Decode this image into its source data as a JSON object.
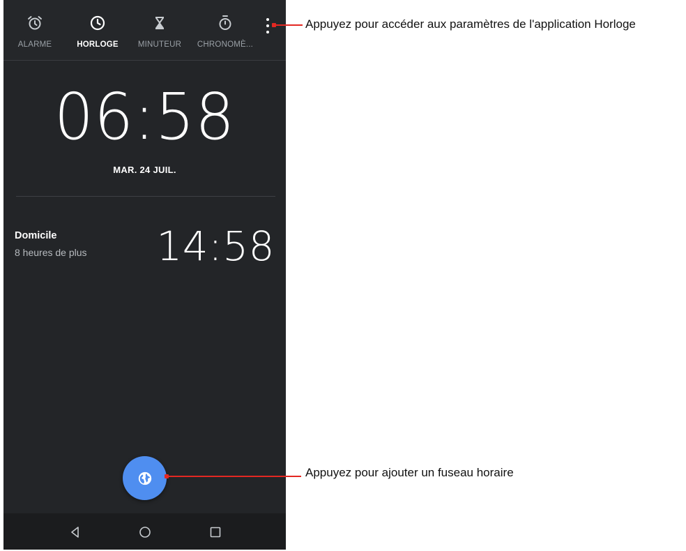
{
  "colors": {
    "background": "#232528",
    "fab": "#4f8ef0",
    "callout_line": "#e32822",
    "nav_bar": "#1b1c1e"
  },
  "tabs": [
    {
      "label": "ALARME",
      "icon": "alarm-clock-icon",
      "active": false
    },
    {
      "label": "HORLOGE",
      "icon": "clock-icon",
      "active": true
    },
    {
      "label": "MINUTEUR",
      "icon": "hourglass-icon",
      "active": false
    },
    {
      "label": "CHRONOMÈ...",
      "icon": "stopwatch-icon",
      "active": false
    }
  ],
  "overflow_icon": "more-vert-icon",
  "clock": {
    "time": "06:58",
    "date": "MAR. 24 JUIL."
  },
  "world_clock": {
    "city": "Domicile",
    "difference": "8 heures de plus",
    "time": "14:58"
  },
  "fab": {
    "icon": "globe-icon"
  },
  "nav": {
    "back_icon": "back-triangle-icon",
    "home_icon": "home-circle-icon",
    "recents_icon": "recents-square-icon"
  },
  "callouts": {
    "settings": "Appuyez pour accéder aux paramètres de l'application Horloge",
    "add_timezone": "Appuyez pour ajouter un fuseau horaire"
  }
}
